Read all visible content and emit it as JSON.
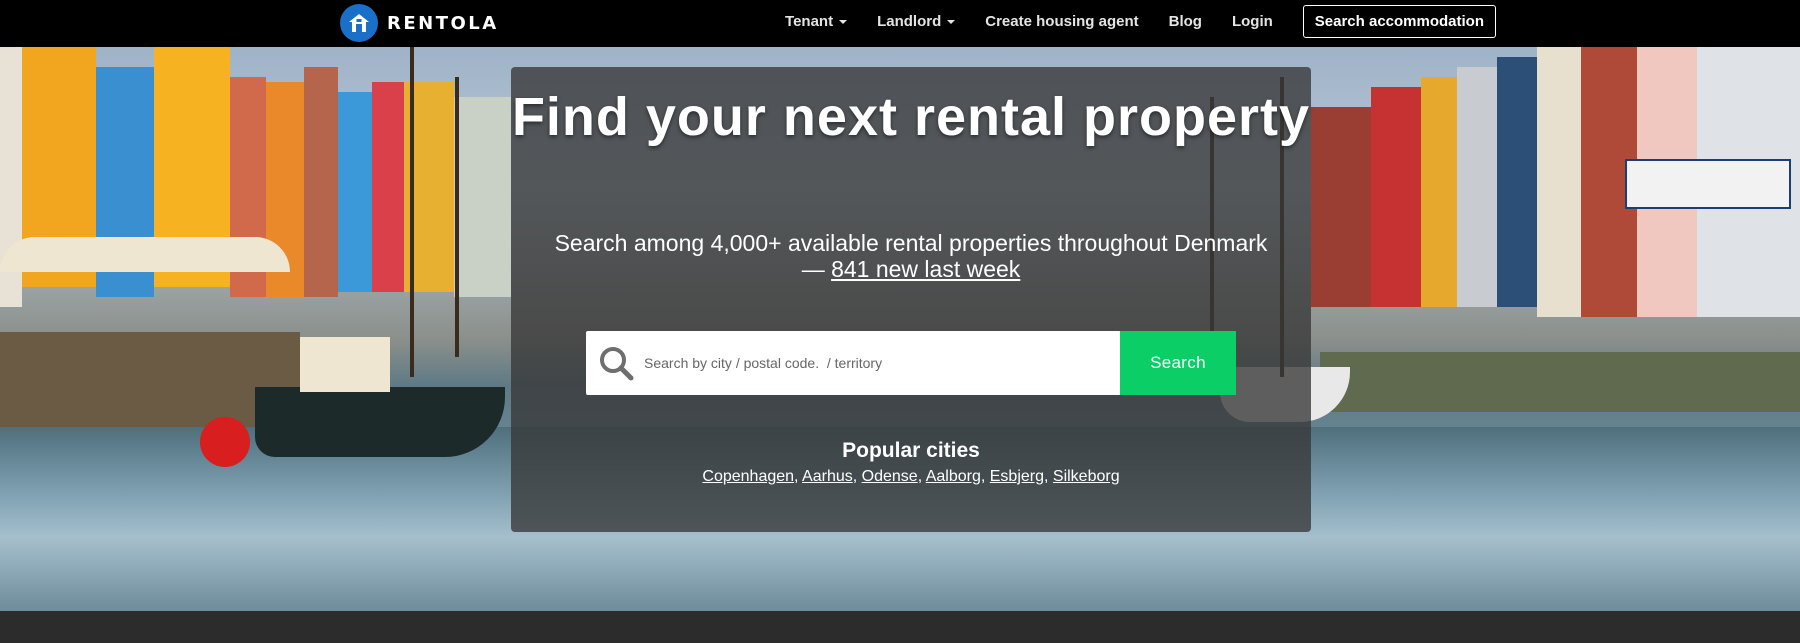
{
  "navbar": {
    "brand": "RENTOLA",
    "items": [
      {
        "label": "Tenant",
        "dropdown": true
      },
      {
        "label": "Landlord",
        "dropdown": true
      },
      {
        "label": "Create housing agent",
        "dropdown": false
      },
      {
        "label": "Blog",
        "dropdown": false
      },
      {
        "label": "Login",
        "dropdown": false
      }
    ],
    "cta": "Search accommodation"
  },
  "hero": {
    "title": "Find your next rental property",
    "subtitle_text": "Search among 4,000+ available rental properties throughout Denmark — ",
    "subtitle_link": "841 new last week",
    "search": {
      "placeholder": "Search by city / postal code.  / territory",
      "value": "",
      "button": "Search"
    },
    "popular": {
      "title": "Popular cities",
      "cities": [
        "Copenhagen",
        "Aarhus",
        "Odense",
        "Aalborg",
        "Esbjerg",
        "Silkeborg"
      ]
    }
  },
  "colors": {
    "brand_blue": "#1a6fc9",
    "search_green": "#0bce67",
    "navbar_bg": "#000000"
  },
  "icons": {
    "logo": "house-icon",
    "search": "search-icon",
    "dropdown": "caret-down-icon"
  }
}
